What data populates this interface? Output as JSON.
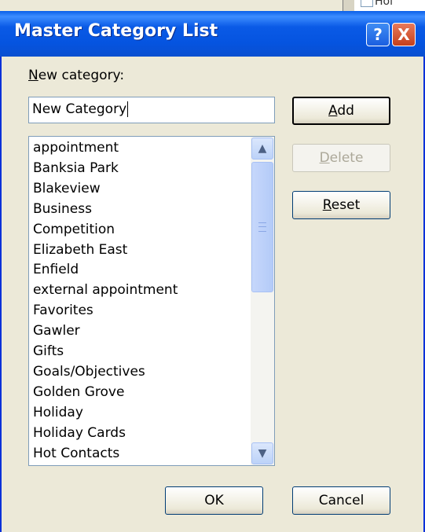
{
  "window": {
    "title": "Master Category List",
    "help_glyph": "?",
    "close_glyph": "X"
  },
  "background_window": {
    "partial_text": "Hol"
  },
  "form": {
    "new_category_label": "New category:",
    "new_category_mnemonic": "N",
    "new_category_value": "New Category"
  },
  "buttons": {
    "add": "Add",
    "delete": "Delete",
    "reset": "Reset",
    "ok": "OK",
    "cancel": "Cancel"
  },
  "categories": [
    "appointment",
    "Banksia Park",
    "Blakeview",
    "Business",
    "Competition",
    "Elizabeth East",
    "Enfield",
    "external appointment",
    "Favorites",
    "Gawler",
    "Gifts",
    "Goals/Objectives",
    "Golden Grove",
    "Holiday",
    "Holiday Cards",
    "Hot Contacts"
  ],
  "scrollbar": {
    "up_icon": "▲",
    "down_icon": "▼"
  },
  "colors": {
    "title_bar": "#0554e0",
    "close_button": "#c5401c",
    "dialog_bg": "#ECE9D8"
  }
}
